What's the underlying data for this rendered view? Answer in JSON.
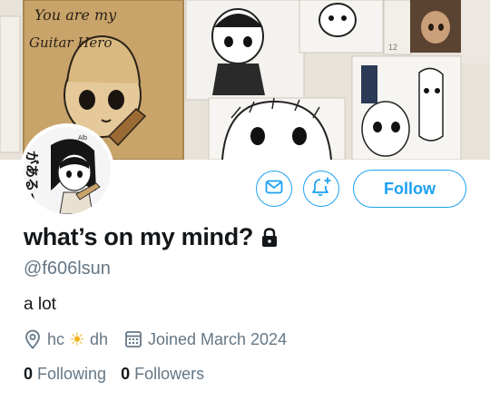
{
  "banner": {
    "text_line1": "You are my",
    "text_line2": "Guitar Hero",
    "number": "12",
    "avatar_badge": "Alb"
  },
  "avatar": {
    "side_text": "があるっ"
  },
  "actions": {
    "message_icon": "mail-icon",
    "notify_icon": "bell-plus-icon",
    "follow_label": "Follow"
  },
  "profile": {
    "display_name": "what’s on my mind?",
    "protected_icon": "lock-icon",
    "handle": "@f606lsun",
    "bio": "a lot",
    "location_part1": "hc",
    "location_sun": "☀",
    "location_part2": "dh",
    "joined": "Joined March 2024",
    "following_count": "0",
    "following_label": "Following",
    "followers_count": "0",
    "followers_label": "Followers"
  },
  "colors": {
    "accent": "#1da1f2",
    "secondary_text": "#657786",
    "primary_text": "#14171a"
  }
}
